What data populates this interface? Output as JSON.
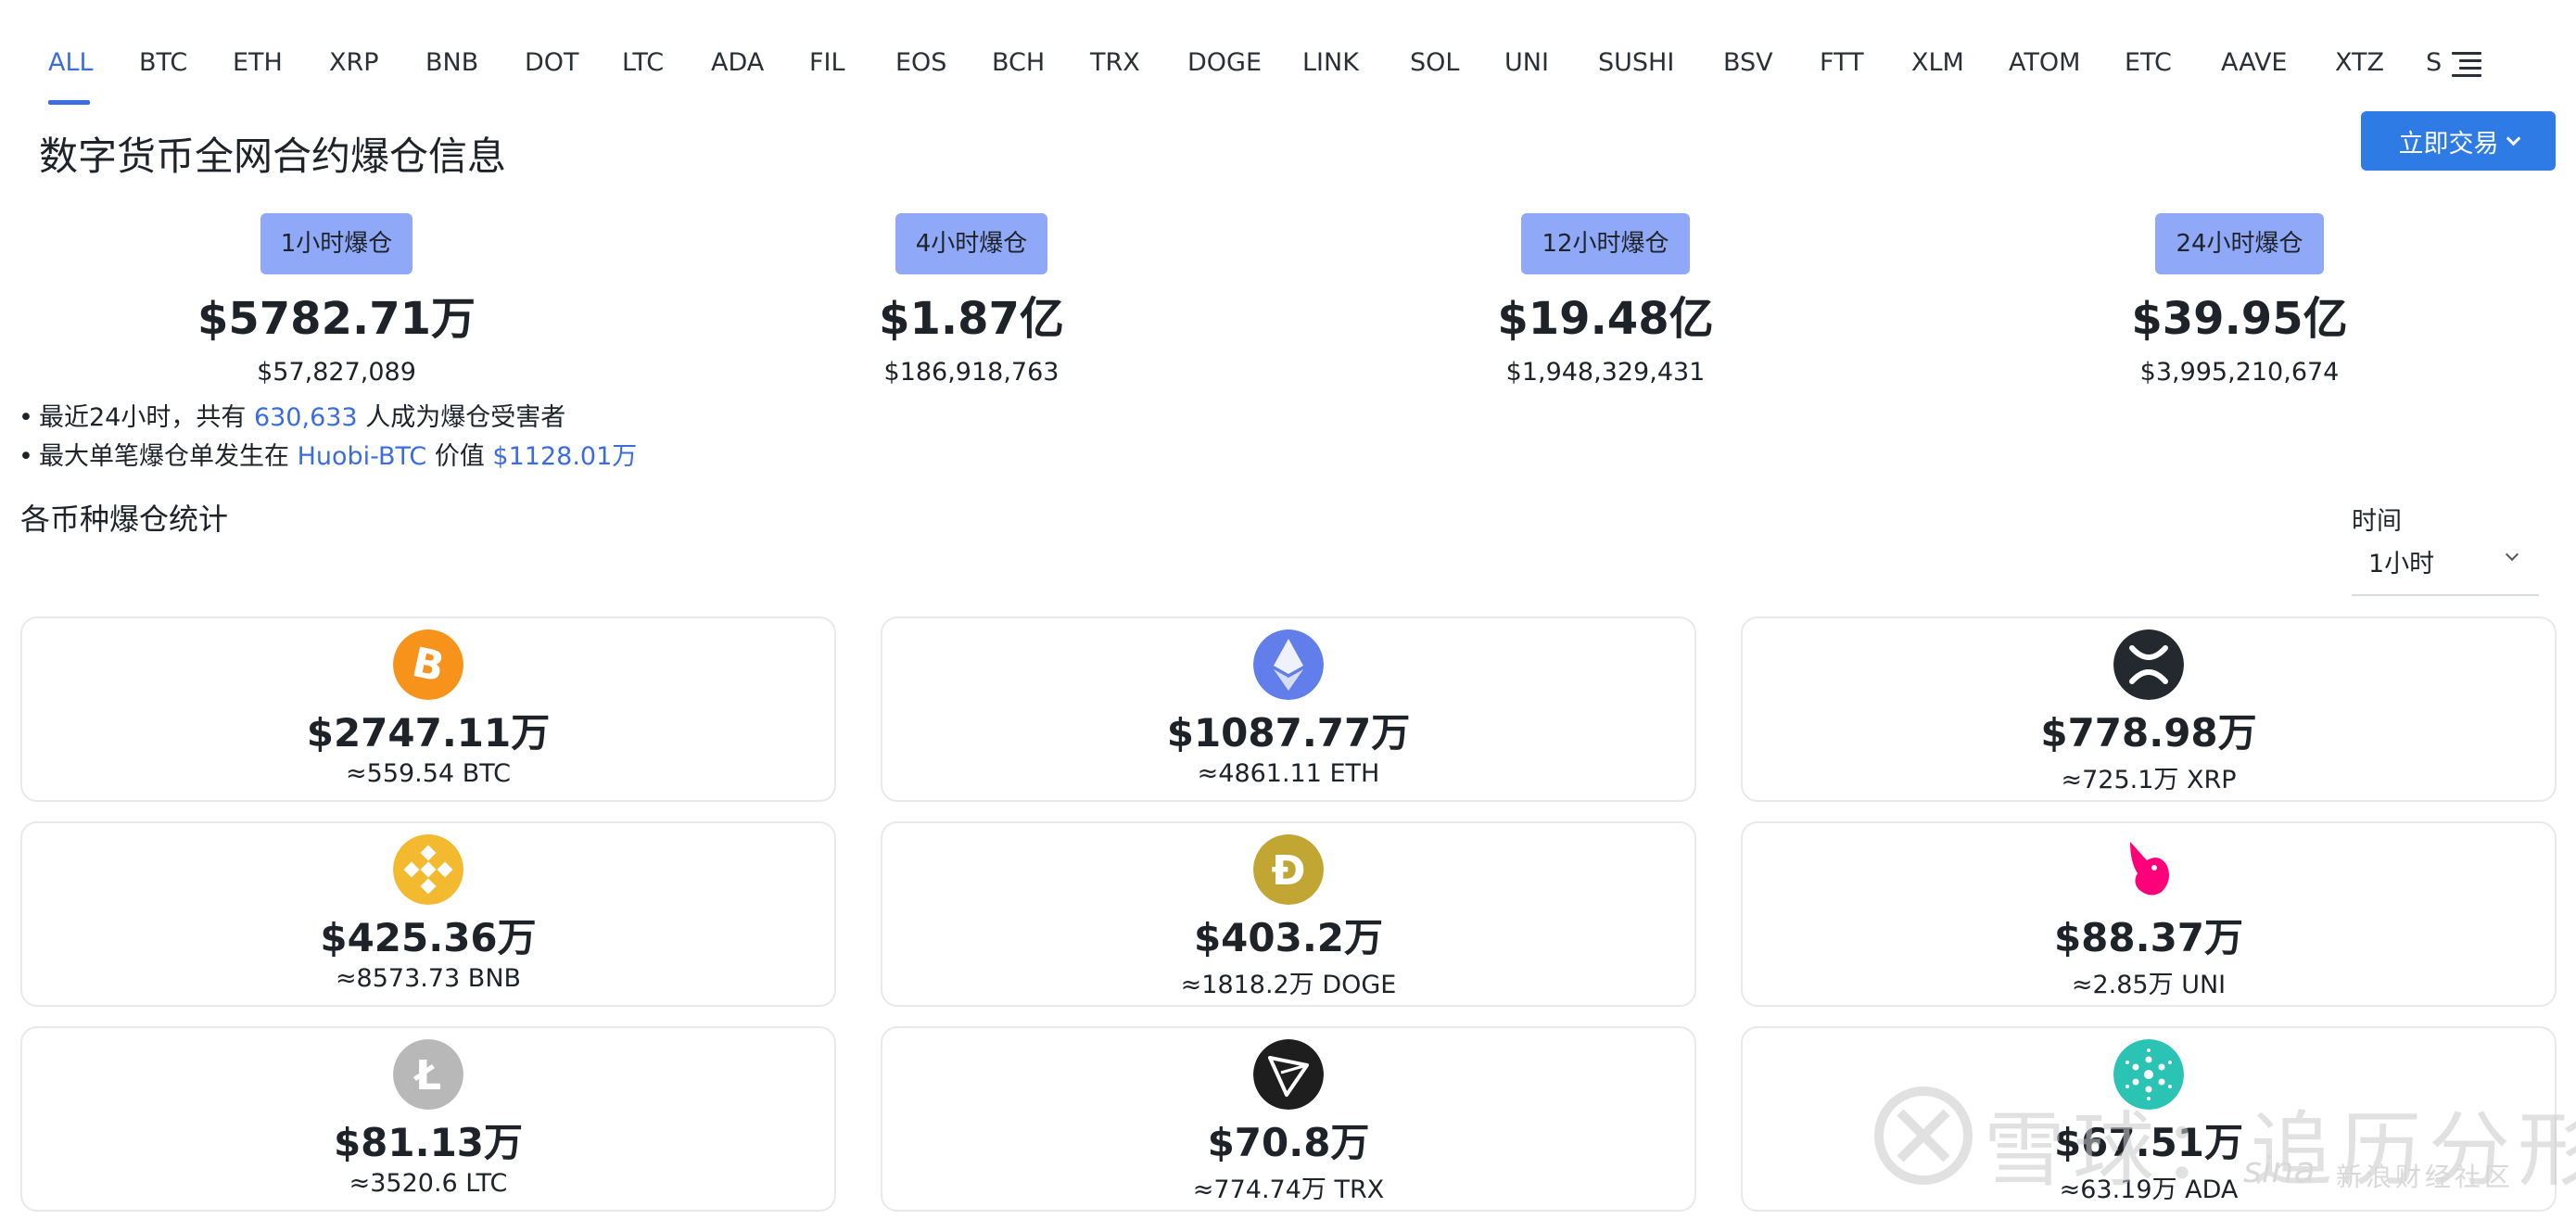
{
  "tabs": [
    "ALL",
    "BTC",
    "ETH",
    "XRP",
    "BNB",
    "DOT",
    "LTC",
    "ADA",
    "FIL",
    "EOS",
    "BCH",
    "TRX",
    "DOGE",
    "LINK",
    "SOL",
    "UNI",
    "SUSHI",
    "BSV",
    "FTT",
    "XLM",
    "ATOM",
    "ETC",
    "AAVE",
    "XTZ",
    "S"
  ],
  "active_tab": "ALL",
  "colors": {
    "accent": "#3b6de0",
    "button": "#2e7be6",
    "label_bg": "#8fa8f7"
  },
  "header": {
    "title": "数字货币全网合约爆仓信息",
    "trade_button": "立即交易"
  },
  "summary": [
    {
      "label": "1小时爆仓",
      "amount": "$5782.71万",
      "exact": "$57,827,089"
    },
    {
      "label": "4小时爆仓",
      "amount": "$1.87亿",
      "exact": "$186,918,763"
    },
    {
      "label": "12小时爆仓",
      "amount": "$19.48亿",
      "exact": "$1,948,329,431"
    },
    {
      "label": "24小时爆仓",
      "amount": "$39.95亿",
      "exact": "$3,995,210,674"
    }
  ],
  "notes": {
    "n1_pre": "最近24小时，共有",
    "n1_count": "630,633",
    "n1_post": "人成为爆仓受害者",
    "n2_pre": "最大单笔爆仓单发生在",
    "n2_exchange": "Huobi-BTC",
    "n2_mid": "价值",
    "n2_value": "$1128.01万"
  },
  "section": {
    "title": "各币种爆仓统计",
    "time_label": "时间",
    "time_value": "1小时"
  },
  "coins": [
    {
      "icon": "btc-icon",
      "value": "$2747.11万",
      "sub": "≈559.54 BTC"
    },
    {
      "icon": "eth-icon",
      "value": "$1087.77万",
      "sub": "≈4861.11 ETH"
    },
    {
      "icon": "xrp-icon",
      "value": "$778.98万",
      "sub": "≈725.1万 XRP"
    },
    {
      "icon": "bnb-icon",
      "value": "$425.36万",
      "sub": "≈8573.73 BNB"
    },
    {
      "icon": "doge-icon",
      "value": "$403.2万",
      "sub": "≈1818.2万 DOGE"
    },
    {
      "icon": "uni-icon",
      "value": "$88.37万",
      "sub": "≈2.85万 UNI"
    },
    {
      "icon": "ltc-icon",
      "value": "$81.13万",
      "sub": "≈3520.6 LTC"
    },
    {
      "icon": "trx-icon",
      "value": "$70.8万",
      "sub": "≈774.74万 TRX"
    },
    {
      "icon": "ada-icon",
      "value": "$67.51万",
      "sub": "≈63.19万 ADA"
    }
  ],
  "watermark": {
    "text": "雪球：追历分形",
    "sina": "sina",
    "sina_cn": "新浪财经社区"
  }
}
